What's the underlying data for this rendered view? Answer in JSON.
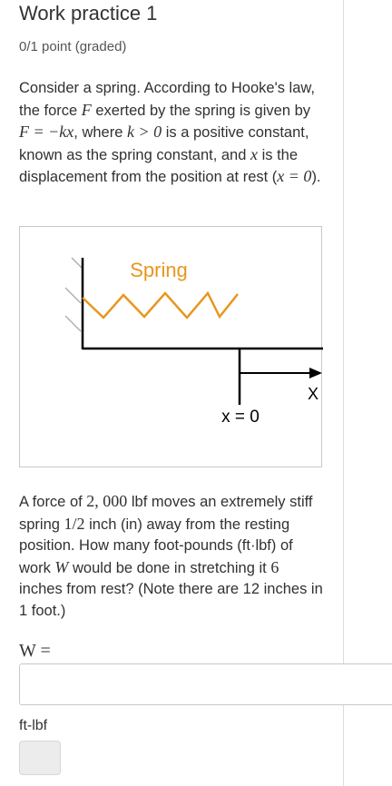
{
  "header": {
    "title": "Work practice 1",
    "points": "0/1 point (graded)"
  },
  "problem": {
    "intro": {
      "p1": "Consider a spring. According to Hooke's law, the force ",
      "F1": "F",
      "p2": " exerted by the spring is given by ",
      "eq": "F = −kx",
      "p3": ", where ",
      "kgt": "k > 0",
      "p4": " is a positive constant, known as the spring constant, and ",
      "x1": "x",
      "p5": " is the displacement from the position at rest (",
      "x0": "x = 0",
      "p6": ")."
    },
    "figure": {
      "spring_label": "Spring",
      "axis_label": "X",
      "origin_label": "x = 0",
      "spring_color": "#e8961e",
      "line_color": "#000000"
    },
    "question": {
      "q1": "A force of ",
      "force": "2, 000",
      "q2": " lbf moves an extremely stiff spring ",
      "half": "1/2",
      "q3": " inch (in) away from the resting position. How many foot-pounds (ft·lbf) of work ",
      "W": "W",
      "q4": " would be done in stretching it ",
      "six": "6",
      "q5": " inches from rest? (Note there are 12 inches in 1 foot.)"
    }
  },
  "answer": {
    "label": "W =",
    "value": "",
    "unit": "ft-lbf"
  }
}
